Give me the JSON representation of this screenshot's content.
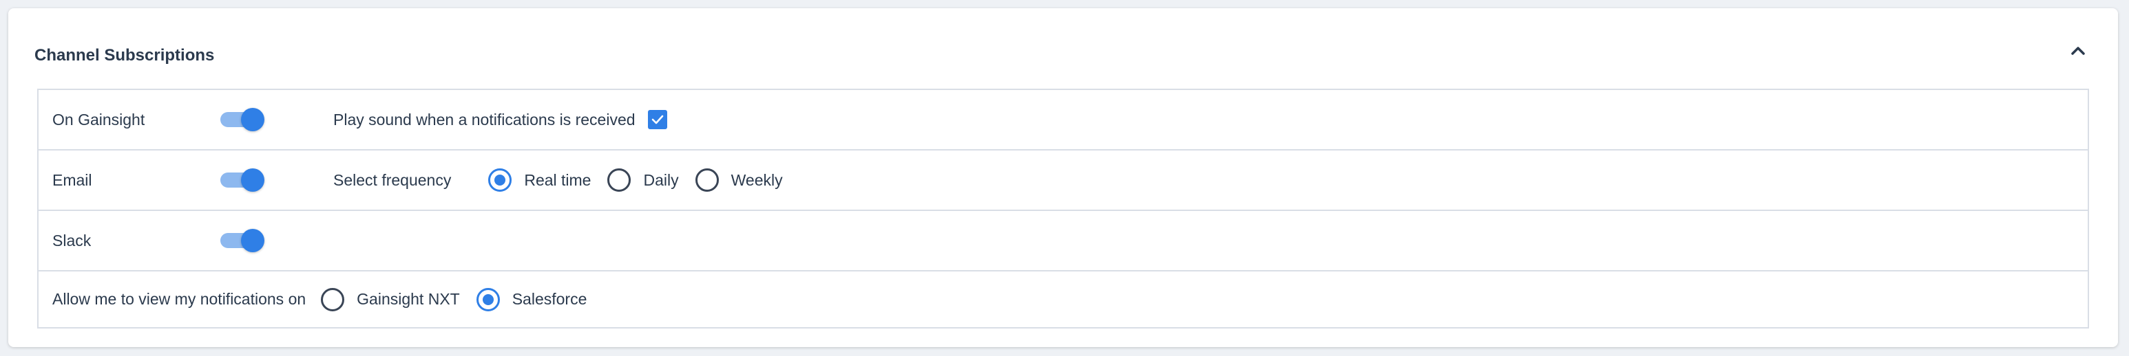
{
  "section": {
    "title": "Channel Subscriptions"
  },
  "rows": [
    {
      "label": "On Gainsight",
      "toggle_on": true,
      "option_label": "Play sound when a notifications is received",
      "checkbox_checked": true
    },
    {
      "label": "Email",
      "toggle_on": true,
      "frequency_label": "Select frequency",
      "frequency_options": [
        {
          "label": "Real time",
          "checked": true
        },
        {
          "label": "Daily",
          "checked": false
        },
        {
          "label": "Weekly",
          "checked": false
        }
      ]
    },
    {
      "label": "Slack",
      "toggle_on": true
    },
    {
      "label": "Allow me to view my notifications on",
      "view_options": [
        {
          "label": "Gainsight NXT",
          "checked": false
        },
        {
          "label": "Salesforce",
          "checked": true
        }
      ]
    }
  ],
  "icons": {
    "collapse": "chevron-up-icon",
    "checkbox": "checkmark-icon"
  },
  "colors": {
    "accent": "#2f7fe6",
    "toggle_track": "#8db8ef",
    "border": "#d9dee6",
    "text": "#2b3a4d"
  }
}
